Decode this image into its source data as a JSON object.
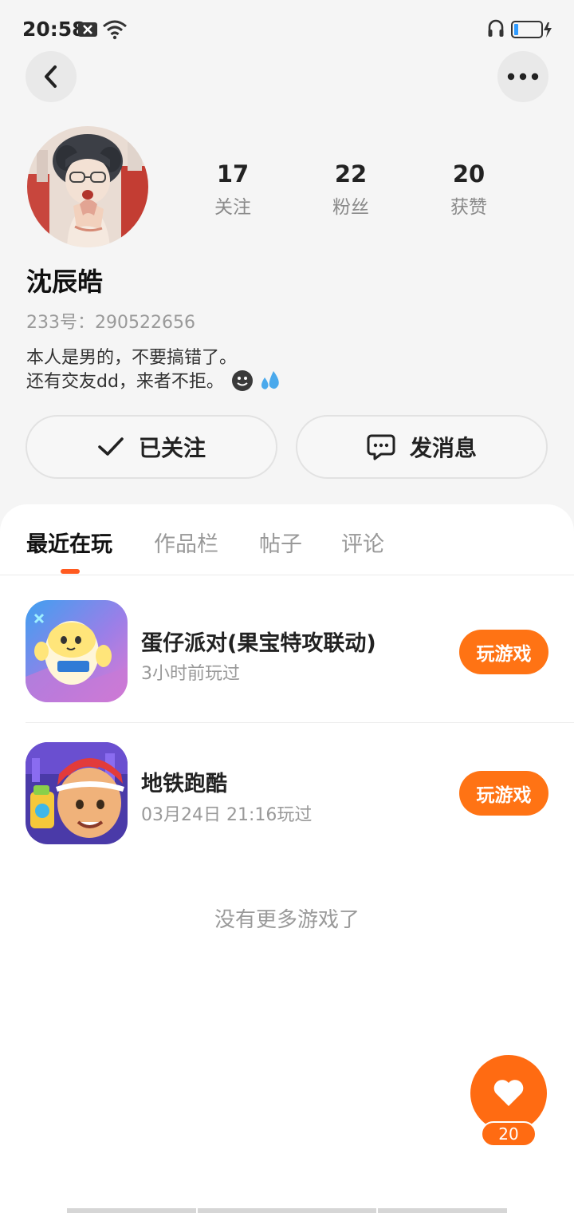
{
  "status_bar": {
    "time": "20:58"
  },
  "profile": {
    "name": "沈辰皓",
    "id_text": "233号：290522656",
    "bio_line1": "本人是男的，不要搞错了。",
    "bio_line2": "还有交友dd，来者不拒。"
  },
  "stats": [
    {
      "value": "17",
      "label": "关注"
    },
    {
      "value": "22",
      "label": "粉丝"
    },
    {
      "value": "20",
      "label": "获赞"
    }
  ],
  "actions": {
    "followed_label": "已关注",
    "message_label": "发消息"
  },
  "tabs": [
    {
      "label": "最近在玩",
      "active": true
    },
    {
      "label": "作品栏"
    },
    {
      "label": "帖子"
    },
    {
      "label": "评论"
    }
  ],
  "games": [
    {
      "title": "蛋仔派对(果宝特攻联动)",
      "time": "3小时前玩过",
      "button": "玩游戏",
      "icon": "eggy-party-icon"
    },
    {
      "title": "地铁跑酷",
      "time": "03月24日 21:16玩过",
      "button": "玩游戏",
      "icon": "subway-surfers-icon"
    }
  ],
  "no_more_text": "没有更多游戏了",
  "like": {
    "count": "20"
  },
  "colors": {
    "accent": "#ff6b12",
    "tab_indicator": "#ff5a1f",
    "background": "#f5f5f5"
  }
}
